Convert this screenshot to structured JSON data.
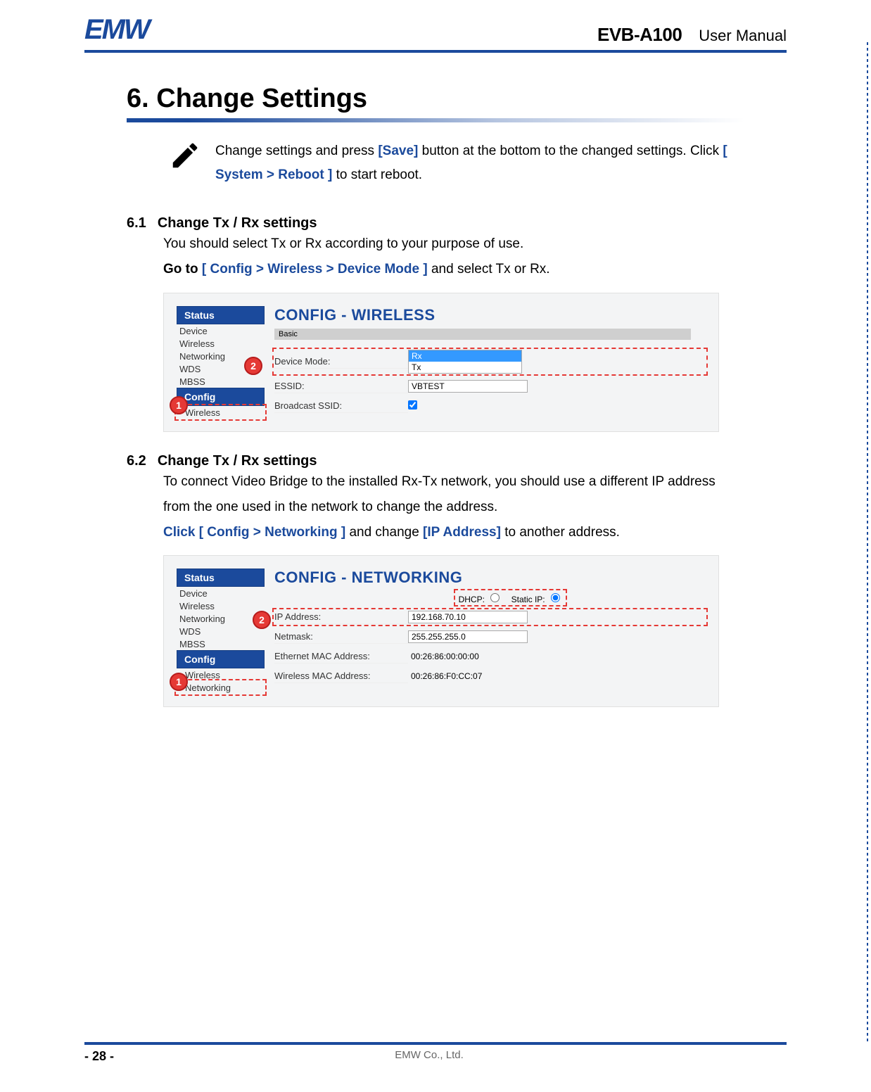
{
  "header": {
    "logo": "EMW",
    "model": "EVB-A100",
    "doc_type": "User Manual"
  },
  "section": {
    "title": "6. Change Settings",
    "note_pre": "Change settings and press ",
    "note_save": "[Save]",
    "note_mid": " button at the bottom to  the changed settings. Click ",
    "note_reboot": "[ System > Reboot ]",
    "note_post": " to start reboot."
  },
  "sub61": {
    "num": "6.1",
    "title": "Change Tx / Rx settings",
    "body1": "You should select Tx or Rx according to your purpose of use.",
    "goto_pre": "Go to ",
    "goto_path": "[ Config > Wireless > Device Mode ]",
    "goto_post": " and select Tx or Rx."
  },
  "ss1": {
    "sidebar": {
      "status": "Status",
      "items": [
        "Device",
        "Wireless",
        "Networking",
        "WDS",
        "MBSS"
      ],
      "config": "Config",
      "cfg_items": [
        "Wireless"
      ]
    },
    "title": "CONFIG - WIRELESS",
    "basic": "Basic",
    "fields": {
      "device_mode": "Device Mode:",
      "opt_rx": "Rx",
      "opt_tx": "Tx",
      "essid": "ESSID:",
      "essid_val": "VBTEST",
      "bcast": "Broadcast SSID:"
    }
  },
  "sub62": {
    "num": "6.2",
    "title": "Change Tx / Rx settings",
    "body1": "To connect Video Bridge to the installed Rx-Tx network, you should use a different IP address from the one used in the network to change the address.",
    "click_pre": "Click ",
    "click_path": "[ Config > Networking ]",
    "click_mid": " and change ",
    "click_ip": "[IP Address]",
    "click_post": " to another address."
  },
  "ss2": {
    "sidebar": {
      "status": "Status",
      "items": [
        "Device",
        "Wireless",
        "Networking",
        "WDS",
        "MBSS"
      ],
      "config": "Config",
      "cfg_items": [
        "Wireless",
        "Networking"
      ]
    },
    "title": "CONFIG - NETWORKING",
    "dhcp_label": "DHCP:",
    "static_label": "Static IP:",
    "fields": {
      "ip_label": "IP Address:",
      "ip_val": "192.168.70.10",
      "netmask_label": "Netmask:",
      "netmask_val": "255.255.255.0",
      "eth_label": "Ethernet MAC Address:",
      "eth_val": "00:26:86:00:00:00",
      "wmac_label": "Wireless MAC Address:",
      "wmac_val": "00:26:86:F0:CC:07"
    }
  },
  "footer": {
    "page": "- 28 -",
    "company": "EMW Co., Ltd."
  },
  "markers": {
    "one": "1",
    "two": "2"
  }
}
